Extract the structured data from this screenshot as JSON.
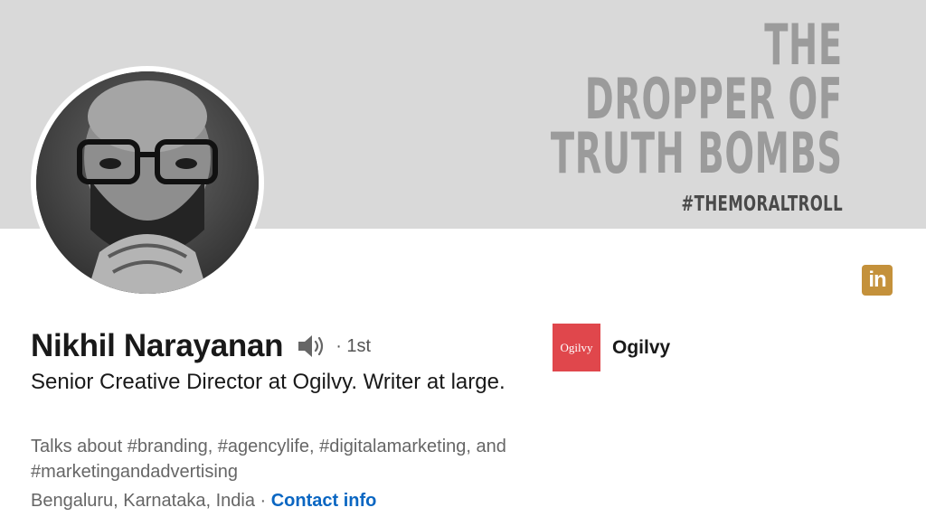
{
  "banner": {
    "lines": [
      "THE",
      "DROPPER OF",
      "TRUTH BOMBS"
    ],
    "hashtag": "#THEMORALTROLL"
  },
  "linkedin_logo_text": "in",
  "profile": {
    "name": "Nikhil Narayanan",
    "connection_degree": "· 1st",
    "headline": "Senior Creative Director at Ogilvy. Writer at large.",
    "talks_about": "Talks about #branding, #agencylife, #digitalamarketing, and #marketingandadvertising",
    "location": "Bengaluru, Karnataka, India · ",
    "contact_info_label": "Contact info"
  },
  "company": {
    "logo_text": "Ogilvy",
    "name": "Ogilvy"
  },
  "colors": {
    "accent_link": "#0a66c2",
    "company_logo_bg": "#e0474c",
    "linkedin_logo_bg": "#c4913b"
  },
  "icons": {
    "speaker": "speaker-icon",
    "linkedin": "linkedin-logo"
  }
}
